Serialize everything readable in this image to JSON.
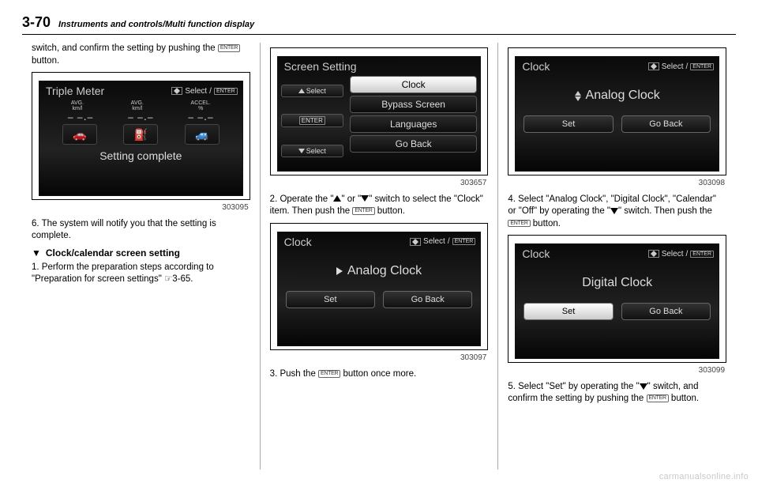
{
  "header": {
    "page_number": "3-70",
    "section": "Instruments and controls/Multi function display"
  },
  "c1": {
    "p1a": "switch, and confirm the setting by pushing the ",
    "p1b": " button.",
    "img1": {
      "title": "Triple Meter",
      "select": "Select",
      "enter": "ENTER",
      "col1_top": "AVG.",
      "col1_bot": "km/l",
      "col2_top": "AVG.",
      "col2_bot": "km/l",
      "col3_top": "ACCEL.",
      "col3_bot": "%",
      "dash": "– –․–",
      "complete": "Setting complete",
      "num": "303095"
    },
    "p2": "6.  The system will notify you that the setting is complete.",
    "sub": "Clock/calendar screen setting",
    "p3": "1.  Perform the preparation steps accord­ing to \"Preparation for screen settings\" ☞3-65."
  },
  "c2": {
    "img1": {
      "title": "Screen Setting",
      "up_select": "Select",
      "dn_select": "Select",
      "enter": "ENTER",
      "items": [
        "Clock",
        "Bypass Screen",
        "Languages",
        "Go Back"
      ],
      "num": "303657"
    },
    "p1a": "2.  Operate the \"",
    "p1b": "\" or \"",
    "p1c": "\" switch to select the \"Clock\" item. Then push the ",
    "p1d": " button.",
    "img2": {
      "title": "Clock",
      "select": "Select",
      "enter": "ENTER",
      "center": "Analog Clock",
      "set": "Set",
      "goback": "Go Back",
      "num": "303097"
    },
    "p2a": "3.  Push the ",
    "p2b": " button once more."
  },
  "c3": {
    "img1": {
      "title": "Clock",
      "select": "Select",
      "enter": "ENTER",
      "center": "Analog Clock",
      "set": "Set",
      "goback": "Go Back",
      "num": "303098"
    },
    "p1a": "4.  Select \"Analog Clock\", \"Digital Clock\", \"Calendar\" or \"Off\" by operating the \"",
    "p1b": "\" switch. Then push the ",
    "p1c": " button.",
    "img2": {
      "title": "Clock",
      "select": "Select",
      "enter": "ENTER",
      "center": "Digital Clock",
      "set": "Set",
      "goback": "Go Back",
      "num": "303099"
    },
    "p2a": "5.  Select \"Set\" by operating the \"",
    "p2b": "\" switch, and confirm the setting by pushing the ",
    "p2c": " button."
  },
  "enter_label": "ENTER",
  "watermark": "carmanualsonline.info"
}
